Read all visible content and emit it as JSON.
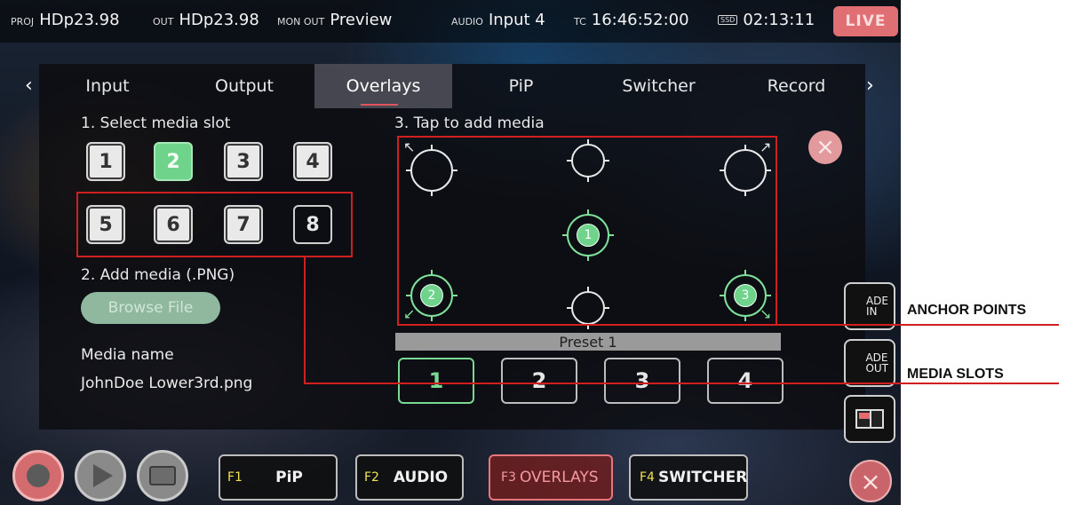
{
  "status_bar": {
    "proj_label": "PROJ",
    "proj_value": "HDp23.98",
    "out_label": "OUT",
    "out_value": "HDp23.98",
    "mon_out_label": "MON OUT",
    "mon_out_value": "Preview",
    "audio_label": "AUDIO",
    "audio_value": "Input 4",
    "tc_label": "TC",
    "tc_value": "16:46:52:00",
    "ssd_label": "SSD",
    "ssd_value": "02:13:11",
    "live_label": "LIVE"
  },
  "tabs": [
    {
      "label": "Input",
      "active": false
    },
    {
      "label": "Output",
      "active": false
    },
    {
      "label": "Overlays",
      "active": true
    },
    {
      "label": "PiP",
      "active": false
    },
    {
      "label": "Switcher",
      "active": false
    },
    {
      "label": "Record",
      "active": false
    }
  ],
  "nav": {
    "prev": "‹",
    "next": "›"
  },
  "media_slots": {
    "heading": "1. Select media slot",
    "slots": [
      "1",
      "2",
      "3",
      "4",
      "5",
      "6",
      "7",
      "8"
    ],
    "selected": "2"
  },
  "add_media": {
    "heading": "2. Add media (.PNG)",
    "browse_label": "Browse File",
    "media_name_label": "Media name",
    "media_name_value": "JohnDoe Lower3rd.png"
  },
  "anchors": {
    "heading": "3. Tap to add media",
    "assigned": [
      {
        "position": "center",
        "label": "1"
      },
      {
        "position": "bottom-left",
        "label": "2"
      },
      {
        "position": "bottom-right",
        "label": "3"
      }
    ],
    "clear_icon": "close-icon"
  },
  "presets": {
    "title": "Preset 1",
    "buttons": [
      "1",
      "2",
      "3",
      "4"
    ],
    "selected": "1"
  },
  "side_buttons": {
    "fade_in": "ADE\nIN",
    "fade_out": "ADE\nOUT"
  },
  "function_keys": [
    {
      "key": "F1",
      "label": "PiP",
      "active": false
    },
    {
      "key": "F2",
      "label": "AUDIO",
      "active": false
    },
    {
      "key": "F3",
      "label": "OVERLAYS",
      "active": true
    },
    {
      "key": "F4",
      "label": "SWITCHER",
      "active": false
    }
  ],
  "annotations": {
    "anchor_points": "ANCHOR POINTS",
    "media_slots": "MEDIA SLOTS"
  },
  "colors": {
    "accent_green": "#6fd38c",
    "live_red": "#e06f73",
    "annotation_red": "#d11f1f",
    "fkey_yellow": "#f2e24e"
  }
}
